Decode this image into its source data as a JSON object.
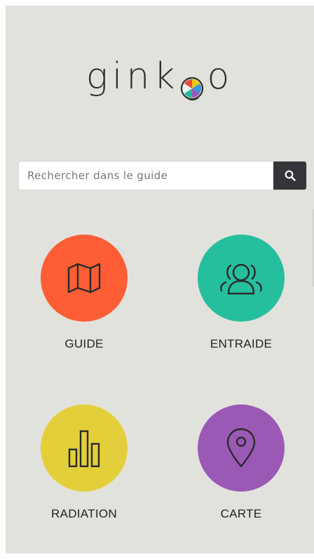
{
  "app": {
    "logo_text_before": "gink",
    "logo_text_after": "o"
  },
  "search": {
    "placeholder": "Rechercher dans le guide",
    "button_icon": "search-icon"
  },
  "tiles": [
    {
      "label": "GUIDE",
      "icon": "map-icon",
      "color": "#ff5d35"
    },
    {
      "label": "ENTRAIDE",
      "icon": "community-icon",
      "color": "#26bf9d"
    },
    {
      "label": "RADIATION",
      "icon": "bar-chart-icon",
      "color": "#e3cf3a"
    },
    {
      "label": "CARTE",
      "icon": "location-pin-icon",
      "color": "#9b59b6"
    }
  ],
  "colors": {
    "background": "#e2e2dd",
    "search_button": "#333538",
    "logo_text": "#2f2f2f"
  }
}
